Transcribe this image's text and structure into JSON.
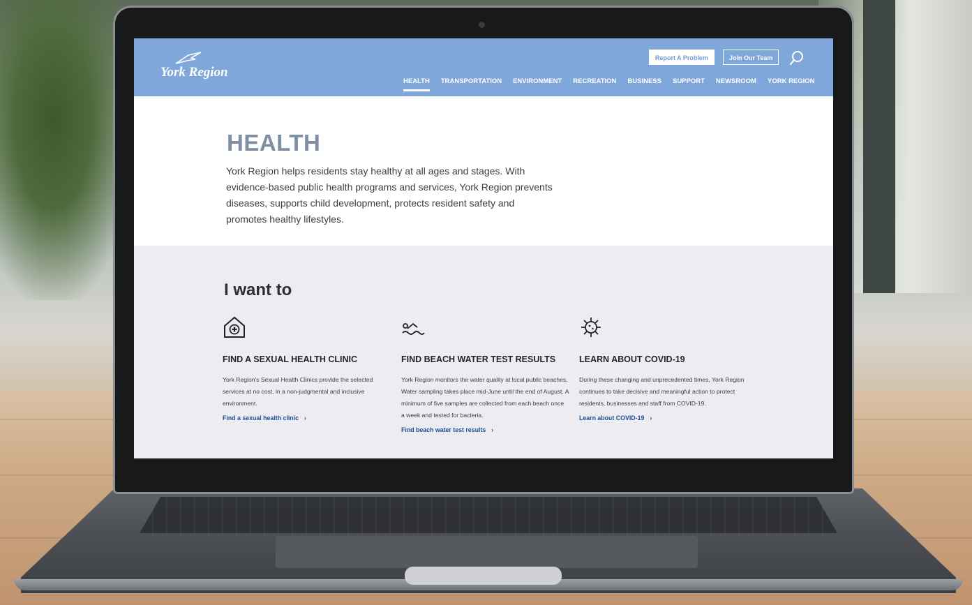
{
  "site": {
    "logo_text": "York Region"
  },
  "header": {
    "utility": {
      "report_label": "Report A Problem",
      "join_label": "Join Our Team"
    },
    "nav": [
      {
        "label": "HEALTH",
        "active": true
      },
      {
        "label": "TRANSPORTATION",
        "active": false
      },
      {
        "label": "ENVIRONMENT",
        "active": false
      },
      {
        "label": "RECREATION",
        "active": false
      },
      {
        "label": "BUSINESS",
        "active": false
      },
      {
        "label": "SUPPORT",
        "active": false
      },
      {
        "label": "NEWSROOM",
        "active": false
      },
      {
        "label": "YORK REGION",
        "active": false
      }
    ]
  },
  "hero": {
    "title": "HEALTH",
    "intro": "York Region helps residents stay healthy at all ages and stages. With evidence-based public health programs and services, York Region prevents diseases, supports child development, protects resident safety and promotes healthy lifestyles."
  },
  "want": {
    "title": "I want to",
    "cards": [
      {
        "icon": "health-clinic-icon",
        "title": "FIND A SEXUAL HEALTH CLINIC",
        "body": "York Region's Sexual Health Clinics provide the selected services at no cost, in a non-judgmental and inclusive environment.",
        "link": "Find a sexual health clinic"
      },
      {
        "icon": "swimmer-icon",
        "title": "FIND BEACH WATER TEST RESULTS",
        "body": "York Region monitors the water quality at local public beaches. Water sampling takes place mid-June until the end of August. A minimum of five samples are collected from each beach once a week and tested for bacteria.",
        "link": "Find beach water test results"
      },
      {
        "icon": "virus-icon",
        "title": "LEARN ABOUT COVID-19",
        "body": "During these changing and unprecedented times, York Region continues to take decisive and meaningful action to protect residents, businesses and staff from COVID-19.",
        "link": "Learn about COVID-19"
      }
    ],
    "chevron": "›"
  },
  "colors": {
    "header_bg": "#7fa7d9",
    "title_gray": "#7f8ea0",
    "section_bg": "#ececf1",
    "link_blue": "#1c4f96"
  }
}
